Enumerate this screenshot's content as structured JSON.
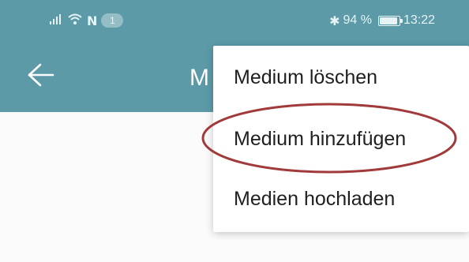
{
  "status_bar": {
    "notification_count": "1",
    "nfc": "N",
    "bluetooth": "✱",
    "battery_percent": "94 %",
    "battery_level": 0.94,
    "time": "13:22",
    "icons": {
      "signal": "signal-icon",
      "wifi": "wifi-icon",
      "nfc": "nfc-icon",
      "bluetooth": "bluetooth-icon",
      "battery": "battery-icon"
    }
  },
  "app_bar": {
    "title": "M",
    "back_icon": "arrow-left-icon"
  },
  "overflow_menu": {
    "items": [
      {
        "label": "Medium löschen"
      },
      {
        "label": "Medium hinzufügen"
      },
      {
        "label": "Medien hochladen"
      }
    ]
  },
  "annotation": {
    "shape": "ellipse",
    "highlighted_item": "Medium hinzufügen",
    "color": "#a13a3a"
  },
  "colors": {
    "app_bar": "#5c9aa8",
    "menu_background": "#ffffff",
    "content_background": "#fbfbfb",
    "menu_text": "#1f1f1f"
  }
}
